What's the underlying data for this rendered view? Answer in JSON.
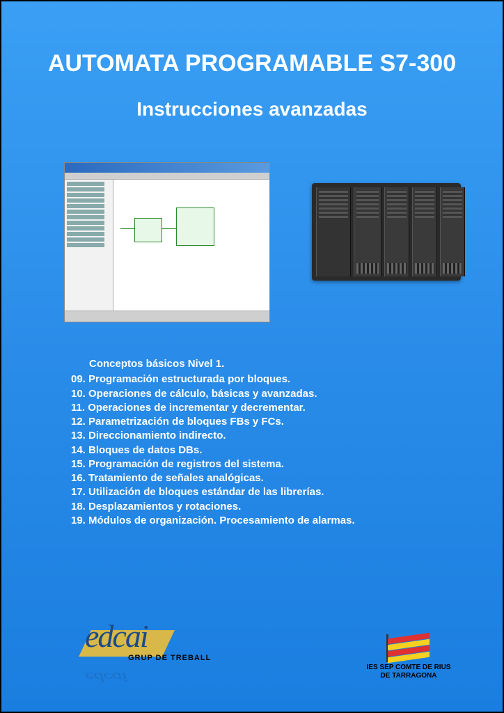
{
  "title": {
    "main": "AUTOMATA PROGRAMABLE S7-300",
    "sub": "Instrucciones avanzadas"
  },
  "toc": {
    "header": "Conceptos básicos Nivel 1.",
    "items": [
      "09. Programación estructurada por bloques.",
      "10. Operaciones de cálculo, básicas y avanzadas.",
      "11. Operaciones de incrementar y decrementar.",
      "12. Parametrización de bloques FBs y FCs.",
      "13. Direccionamiento indirecto.",
      "14. Bloques de datos DBs.",
      "15. Programación de registros del sistema.",
      "16. Tratamiento de señales analógicas.",
      "17. Utilización de bloques estándar de las librerías.",
      "18. Desplazamientos y rotaciones.",
      "19. Módulos de organización. Procesamiento de alarmas."
    ]
  },
  "footer": {
    "left_logo_text": "edcai",
    "left_logo_sub": "GRUP DE TREBALL",
    "right_caption_line1": "IES SEP COMTE DE RIUS",
    "right_caption_line2": "DE TARRAGONA"
  }
}
